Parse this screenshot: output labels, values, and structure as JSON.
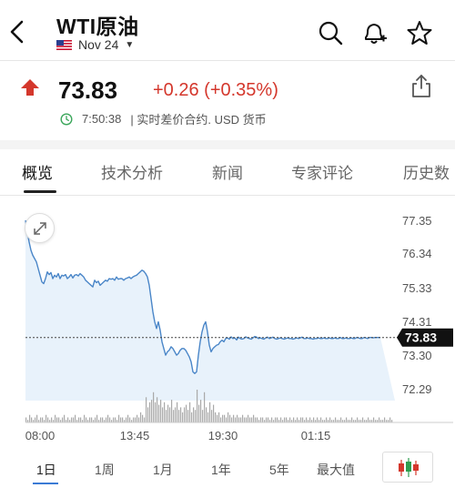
{
  "header": {
    "title": "WTI原油",
    "contract": "Nov 24",
    "back_icon": "chevron-left-icon",
    "icons": [
      "search-icon",
      "bell-plus-icon",
      "star-icon"
    ]
  },
  "quote": {
    "price": "73.83",
    "change": "+0.26 (+0.35%)",
    "direction": "up",
    "time": "7:50:38",
    "status_text": "| 实时差价合约. USD 货币"
  },
  "tabs": [
    {
      "label": "概览",
      "active": true
    },
    {
      "label": "技术分析",
      "active": false
    },
    {
      "label": "新闻",
      "active": false
    },
    {
      "label": "专家评论",
      "active": false
    },
    {
      "label": "历史数",
      "active": false
    }
  ],
  "chart_data": {
    "type": "line",
    "y_ticks": [
      "77.35",
      "76.34",
      "75.33",
      "74.31",
      "73.30",
      "72.29"
    ],
    "x_ticks": [
      "08:00",
      "13:45",
      "19:30",
      "01:15"
    ],
    "ylim": [
      72.0,
      77.5
    ],
    "current_value": "73.83",
    "current_value_num": 73.83,
    "x": [
      0,
      2,
      4,
      6,
      8,
      10,
      12,
      14,
      16,
      18,
      20,
      22,
      24,
      26,
      28,
      30,
      32,
      34,
      36,
      38,
      40,
      42,
      44,
      46,
      48,
      50,
      52,
      54,
      56,
      58,
      60,
      62,
      64,
      66,
      68,
      70,
      72,
      74,
      76,
      78,
      80,
      82,
      84,
      86,
      88,
      90,
      92,
      94,
      96,
      98,
      100,
      102,
      104,
      106,
      108,
      110,
      112,
      114,
      116,
      118,
      120,
      122,
      124,
      126,
      128,
      130,
      132,
      134,
      136,
      138,
      140,
      142,
      144,
      146,
      148,
      150,
      152,
      154,
      156,
      158,
      160,
      162,
      164,
      166,
      168,
      170,
      172,
      174,
      176,
      178,
      180,
      182,
      184,
      186,
      188,
      190,
      192,
      194,
      196,
      198,
      200,
      202,
      204,
      206,
      208,
      210,
      212,
      214,
      216,
      218,
      220,
      222,
      224,
      226,
      228,
      230,
      232,
      234,
      236,
      238,
      240,
      242,
      244,
      246,
      248,
      250,
      252,
      254,
      256,
      258,
      260,
      262,
      264,
      266,
      268,
      270,
      272,
      274,
      276,
      278,
      280,
      282,
      284,
      286,
      288,
      290,
      292,
      294,
      296,
      298,
      300,
      302,
      304,
      306,
      308,
      310,
      312,
      314,
      316,
      318,
      320,
      322,
      324,
      326,
      328,
      330,
      332,
      334,
      336,
      338,
      340,
      342,
      344,
      346,
      348,
      350,
      352,
      354,
      356,
      358,
      360,
      362,
      364,
      366,
      368,
      370,
      372,
      374,
      376,
      378,
      380,
      382,
      384,
      386,
      388,
      390,
      392,
      394,
      396,
      398,
      400,
      402,
      404,
      406
    ],
    "values": [
      77.35,
      77.0,
      76.7,
      76.45,
      76.3,
      76.2,
      76.1,
      75.9,
      75.7,
      75.5,
      75.45,
      75.6,
      75.8,
      75.72,
      75.78,
      75.6,
      75.7,
      75.65,
      75.75,
      75.6,
      75.7,
      75.68,
      75.72,
      75.6,
      75.65,
      75.72,
      75.62,
      75.7,
      75.72,
      75.68,
      75.75,
      75.7,
      75.65,
      75.55,
      75.5,
      75.45,
      75.4,
      75.35,
      75.55,
      75.48,
      75.52,
      75.4,
      75.45,
      75.5,
      75.55,
      75.52,
      75.6,
      75.58,
      75.6,
      75.55,
      75.65,
      75.58,
      75.6,
      75.6,
      75.55,
      75.6,
      75.62,
      75.65,
      75.6,
      75.65,
      75.68,
      75.7,
      75.75,
      75.8,
      75.85,
      75.82,
      75.75,
      75.65,
      75.4,
      75.0,
      74.6,
      74.3,
      74.1,
      74.3,
      74.05,
      73.7,
      73.5,
      73.3,
      73.4,
      73.45,
      73.55,
      73.5,
      73.4,
      73.3,
      73.35,
      73.45,
      73.5,
      73.5,
      73.45,
      73.35,
      73.25,
      73.1,
      72.8,
      72.75,
      72.8,
      73.3,
      73.7,
      74.0,
      74.2,
      74.3,
      74.0,
      73.6,
      73.4,
      73.5,
      73.55,
      73.6,
      73.62,
      73.7,
      73.75,
      73.7,
      73.8,
      73.82,
      73.78,
      73.85,
      73.8,
      73.82,
      73.76,
      73.84,
      73.8,
      73.78,
      73.8,
      73.85,
      73.82,
      73.8,
      73.78,
      73.82,
      73.86,
      73.84,
      73.8,
      73.82,
      73.8,
      73.78,
      73.82,
      73.84,
      73.8,
      73.82,
      73.84,
      73.8,
      73.78,
      73.8,
      73.82,
      73.8,
      73.78,
      73.8,
      73.82,
      73.8,
      73.8,
      73.78,
      73.8,
      73.82,
      73.8,
      73.82,
      73.84,
      73.8,
      73.8,
      73.82,
      73.8,
      73.8,
      73.78,
      73.8,
      73.8,
      73.82,
      73.8,
      73.8,
      73.82,
      73.8,
      73.8,
      73.82,
      73.8,
      73.8,
      73.82,
      73.8,
      73.8,
      73.83,
      73.8,
      73.8,
      73.82,
      73.8,
      73.8,
      73.82,
      73.8,
      73.8,
      73.83,
      73.82,
      73.8,
      73.8,
      73.83,
      73.82,
      73.8,
      73.83,
      73.83,
      73.82,
      73.83,
      73.83,
      73.83,
      73.83
    ],
    "volume": [
      2,
      1,
      3,
      2,
      1,
      2,
      3,
      1,
      2,
      2,
      1,
      3,
      2,
      1,
      2,
      1,
      3,
      2,
      2,
      1,
      2,
      3,
      1,
      2,
      1,
      2,
      2,
      3,
      1,
      2,
      2,
      1,
      3,
      2,
      1,
      2,
      2,
      1,
      2,
      3,
      1,
      2,
      2,
      1,
      2,
      3,
      2,
      1,
      2,
      2,
      1,
      3,
      2,
      2,
      1,
      2,
      3,
      2,
      1,
      2,
      2,
      3,
      2,
      4,
      3,
      2,
      10,
      6,
      8,
      9,
      12,
      8,
      10,
      7,
      9,
      6,
      8,
      5,
      7,
      6,
      9,
      5,
      6,
      8,
      5,
      6,
      4,
      6,
      7,
      5,
      8,
      4,
      6,
      5,
      13,
      7,
      9,
      5,
      12,
      6,
      4,
      8,
      5,
      7,
      4,
      3,
      4,
      2,
      3,
      3,
      2,
      4,
      3,
      2,
      3,
      2,
      3,
      2,
      2,
      3,
      2,
      2,
      3,
      2,
      2,
      3,
      2,
      2,
      1,
      2,
      2,
      1,
      2,
      2,
      1,
      2,
      1,
      2,
      2,
      1,
      2,
      1,
      2,
      2,
      1,
      2,
      1,
      2,
      1,
      2,
      1,
      2,
      2,
      1,
      2,
      1,
      2,
      1,
      2,
      1,
      2,
      1,
      2,
      1,
      1,
      2,
      1,
      2,
      1,
      1,
      2,
      1,
      1,
      2,
      1,
      1,
      2,
      1,
      1,
      2,
      1,
      1,
      2,
      1,
      1,
      2,
      1,
      1,
      2,
      1,
      1,
      2,
      1,
      1,
      2,
      1,
      1,
      2,
      1,
      1,
      2,
      1
    ]
  },
  "periods": [
    {
      "label": "1日",
      "active": true
    },
    {
      "label": "1周",
      "active": false
    },
    {
      "label": "1月",
      "active": false
    },
    {
      "label": "1年",
      "active": false
    },
    {
      "label": "5年",
      "active": false
    },
    {
      "label": "最大值",
      "active": false
    }
  ],
  "colors": {
    "up_red": "#d4372c",
    "line_blue": "#4a86c8",
    "fill_blue": "#e8f2fb",
    "volume_gray": "#a9a9a9"
  }
}
